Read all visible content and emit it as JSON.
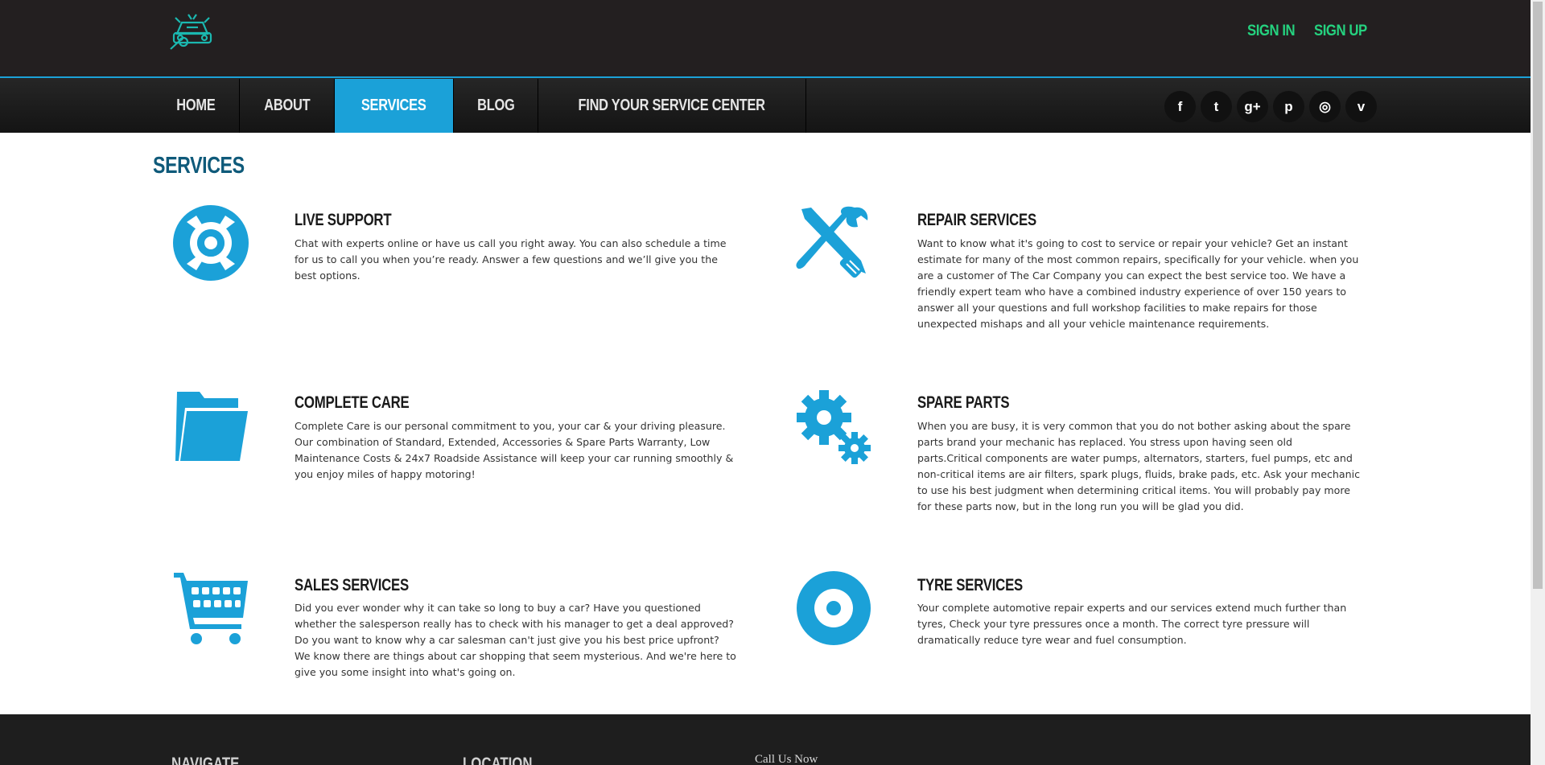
{
  "header": {
    "logo_icon": "car-wrench-logo-icon",
    "sign_in": "SIGN IN",
    "sign_up": "SIGN UP"
  },
  "nav": {
    "items": [
      {
        "label": "HOME",
        "active": false
      },
      {
        "label": "ABOUT",
        "active": false
      },
      {
        "label": "SERVICES",
        "active": true
      },
      {
        "label": "BLOG",
        "active": false
      },
      {
        "label": "FIND YOUR SERVICE CENTER",
        "active": false
      }
    ],
    "socials": [
      {
        "icon": "facebook-icon",
        "glyph": "f"
      },
      {
        "icon": "twitter-icon",
        "glyph": "t"
      },
      {
        "icon": "google-plus-icon",
        "glyph": "g+"
      },
      {
        "icon": "pinterest-icon",
        "glyph": "p"
      },
      {
        "icon": "dribbble-icon",
        "glyph": "◎"
      },
      {
        "icon": "vimeo-icon",
        "glyph": "v"
      }
    ]
  },
  "page": {
    "title": "SERVICES"
  },
  "services": [
    {
      "title": "LIVE SUPPORT",
      "icon": "lifebuoy-icon",
      "description": "Chat with experts online or have us call you right away. You can also schedule a time for us to call you when you’re ready. Answer a few questions and we’ll give you the best options."
    },
    {
      "title": "REPAIR SERVICES",
      "icon": "wrench-screwdriver-icon",
      "description": "Want to know what it's going to cost to service or repair your vehicle? Get an instant estimate for many of the most common repairs, specifically for your vehicle. when you are a customer of The Car Company you can expect the best service too. We have a friendly expert team who have a combined industry experience of over 150 years to answer all your questions and full workshop facilities to make repairs for those unexpected mishaps and all your vehicle maintenance requirements."
    },
    {
      "title": "COMPLETE CARE",
      "icon": "folder-icon",
      "description": "Complete Care is our personal commitment to you, your car & your driving pleasure. Our combination of Standard, Extended, Accessories & Spare Parts Warranty, Low Maintenance Costs & 24x7 Roadside Assistance will keep your car running smoothly & you enjoy miles of happy motoring!"
    },
    {
      "title": "SPARE PARTS",
      "icon": "gears-icon",
      "description": "When you are busy, it is very common that you do not bother asking about the spare parts brand your mechanic has replaced. You stress upon having seen old parts.Critical components are water pumps, alternators, starters, fuel pumps, etc and non-critical items are air filters, spark plugs, fluids, brake pads, etc. Ask your mechanic to use his best judgment when determining critical items. You will probably pay more for these parts now, but in the long run you will be glad you did."
    },
    {
      "title": "SALES SERVICES",
      "icon": "shopping-cart-icon",
      "description": "Did you ever wonder why it can take so long to buy a car? Have you questioned whether the salesperson really has to check with his manager to get a deal approved? Do you want to know why a car salesman can't just give you his best price upfront? We know there are things about car shopping that seem mysterious. And we're here to give you some insight into what's going on."
    },
    {
      "title": "TYRE SERVICES",
      "icon": "tyre-icon",
      "description": "Your complete automotive repair experts and our services extend much further than tyres, Check your tyre pressures once a month. The correct tyre pressure will dramatically reduce tyre wear and fuel consumption."
    }
  ],
  "footer": {
    "navigate": "NAVIGATE",
    "location": "LOCATION",
    "call": "Call Us Now"
  },
  "colors": {
    "accent": "#1ba1d8",
    "header_bg": "#231f20",
    "auth_green": "#25d27f",
    "title_blue": "#0f5a7a"
  }
}
